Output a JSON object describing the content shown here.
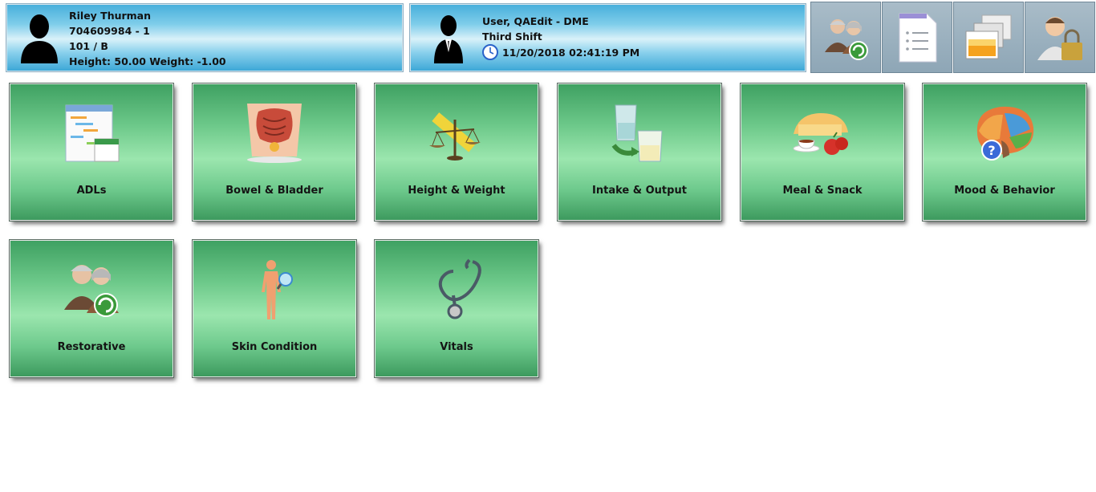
{
  "patient": {
    "name": "Riley Thurman",
    "id": "704609984 - 1",
    "room": "101 / B",
    "vitals": "Height: 50.00 Weight: -1.00"
  },
  "user": {
    "name": "User, QAEdit - DME",
    "shift": "Third Shift",
    "datetime": "11/20/2018 02:41:19 PM"
  },
  "tools": [
    {
      "icon": "residents-refresh-icon"
    },
    {
      "icon": "document-list-icon"
    },
    {
      "icon": "windows-icon"
    },
    {
      "icon": "user-lock-icon"
    }
  ],
  "tiles": [
    {
      "label": "ADLs",
      "icon": "calendar-schedule-icon"
    },
    {
      "label": "Bowel & Bladder",
      "icon": "digestive-system-icon"
    },
    {
      "label": "Height & Weight",
      "icon": "scale-ruler-icon"
    },
    {
      "label": "Intake & Output",
      "icon": "measuring-cups-icon"
    },
    {
      "label": "Meal & Snack",
      "icon": "food-icon"
    },
    {
      "label": "Mood & Behavior",
      "icon": "brain-question-icon"
    },
    {
      "label": "Restorative",
      "icon": "elderly-couple-refresh-icon"
    },
    {
      "label": "Skin Condition",
      "icon": "body-magnifier-icon"
    },
    {
      "label": "Vitals",
      "icon": "stethoscope-icon"
    }
  ],
  "colors": {
    "header_blue": "#46aedb",
    "tile_green": "#6cc889",
    "toolbar_gray": "#8ea6b6"
  }
}
